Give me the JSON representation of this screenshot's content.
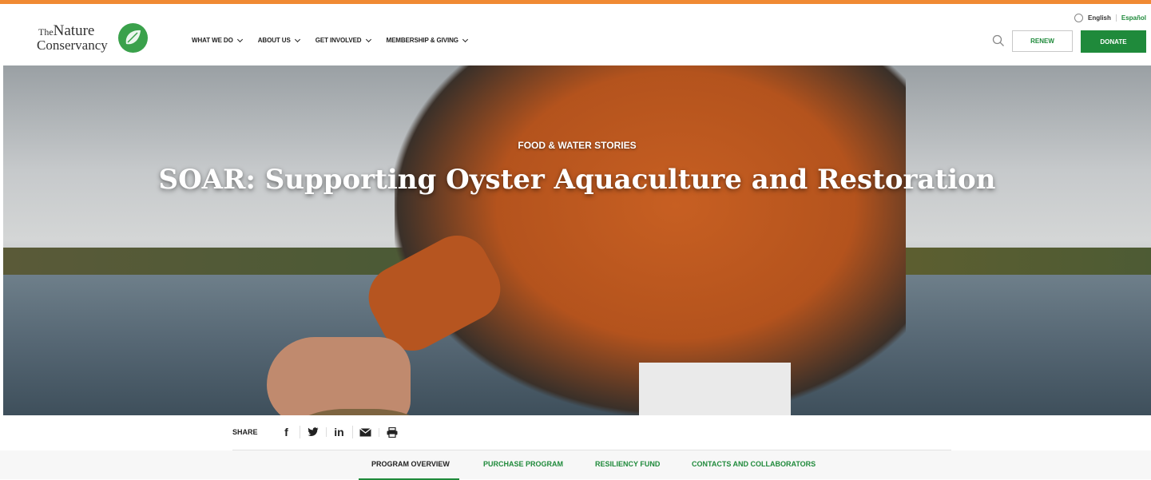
{
  "language": {
    "english": "English",
    "espanol": "Español"
  },
  "brand": {
    "line1_prefix": "The",
    "line1": "Nature",
    "line2": "Conservancy"
  },
  "nav": {
    "items": [
      {
        "label": "WHAT WE DO"
      },
      {
        "label": "ABOUT US"
      },
      {
        "label": "GET INVOLVED"
      },
      {
        "label": "MEMBERSHIP & GIVING"
      }
    ],
    "renew": "RENEW",
    "donate": "DONATE"
  },
  "hero": {
    "eyebrow": "FOOD & WATER STORIES",
    "title": "SOAR: Supporting Oyster Aquaculture and Restoration"
  },
  "share": {
    "label": "SHARE",
    "icons": [
      "facebook-icon",
      "twitter-icon",
      "linkedin-icon",
      "email-icon",
      "print-icon"
    ]
  },
  "tabs": [
    {
      "label": "PROGRAM OVERVIEW",
      "active": true
    },
    {
      "label": "PURCHASE PROGRAM"
    },
    {
      "label": "RESILIENCY FUND"
    },
    {
      "label": "CONTACTS AND COLLABORATORS"
    }
  ],
  "colors": {
    "accent_top": "#f08a33",
    "brand_green": "#1f8a3b"
  }
}
